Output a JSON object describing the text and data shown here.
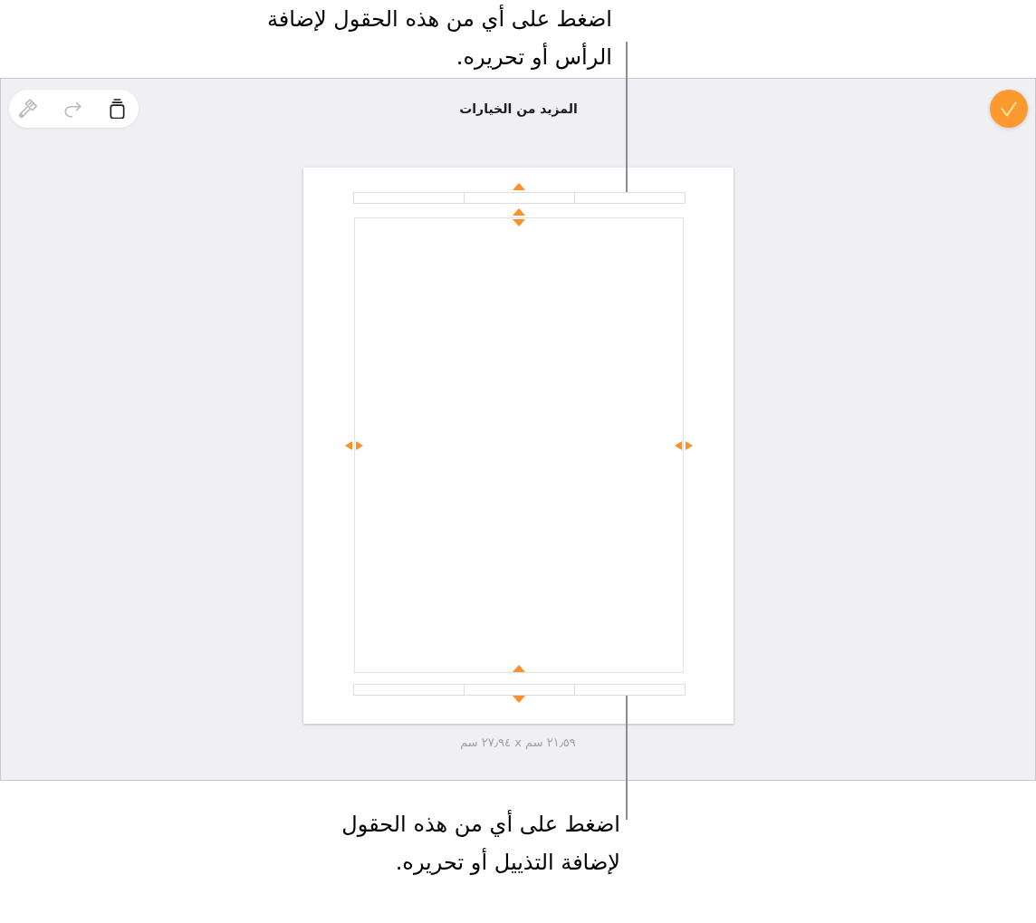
{
  "header_callout": {
    "text": "اضغط على أي من هذه الحقول لإضافة الرأس أو تحريره."
  },
  "toolbar": {
    "buttons": [
      {
        "kind": "paintbrush",
        "disabled": true
      },
      {
        "kind": "redo",
        "disabled": true
      },
      {
        "kind": "stack",
        "disabled": false
      }
    ]
  },
  "title": "المزيد من الخيارات",
  "page_size": "٢١٫٥٩ سم x ٢٧٫٩٤ سم",
  "footer_callout": {
    "text": "اضغط على أي من هذه الحقول لإضافة التذييل أو تحريره."
  }
}
